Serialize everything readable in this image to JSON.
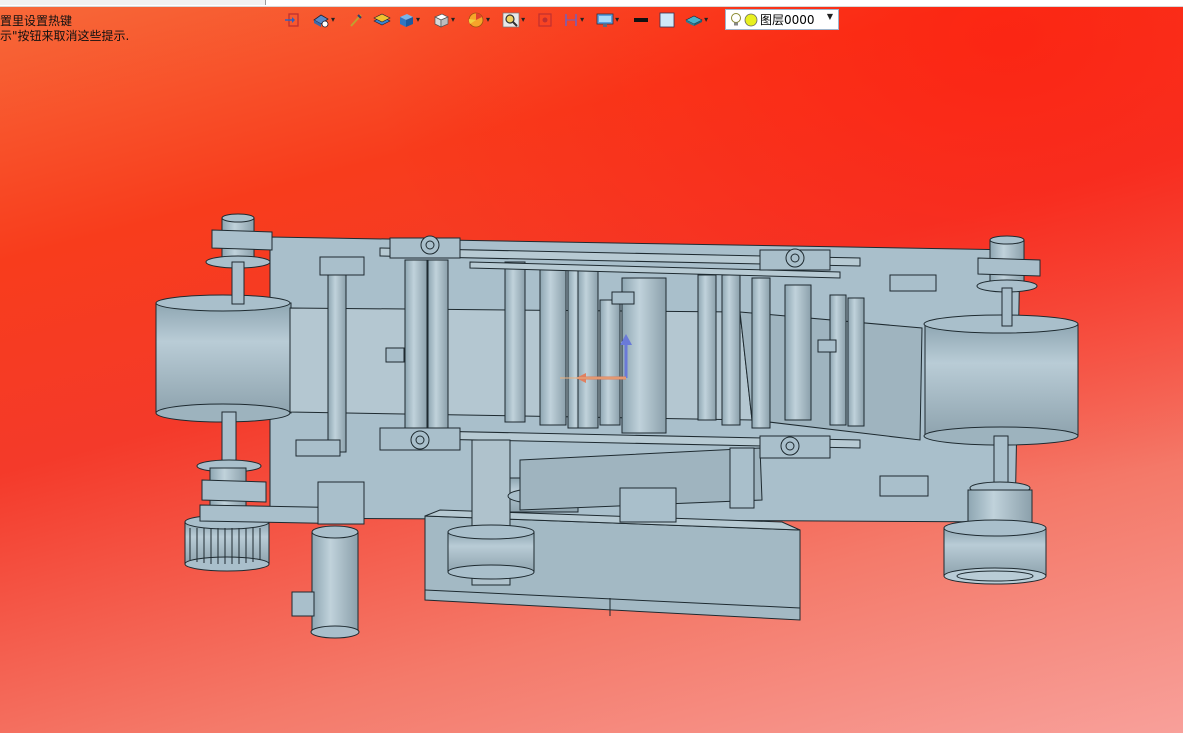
{
  "hints": {
    "line1": "置里设置热键",
    "line2": "示\"按钮来取消这些提示."
  },
  "toolbar": {
    "items": [
      {
        "name": "exit-sketch-icon"
      },
      {
        "name": "view-orientation-icon"
      },
      {
        "name": "line-style-icon"
      },
      {
        "name": "layers-icon"
      },
      {
        "name": "render-style-icon"
      },
      {
        "name": "standard-views-icon"
      },
      {
        "name": "color-wheel-icon"
      },
      {
        "name": "zoom-icon"
      },
      {
        "name": "fit-view-icon"
      },
      {
        "name": "section-view-icon"
      },
      {
        "name": "display-settings-icon"
      },
      {
        "name": "line-color-icon"
      },
      {
        "name": "fill-color-icon"
      },
      {
        "name": "material-icon"
      }
    ]
  },
  "layer": {
    "value": "图层0000"
  },
  "colors": {
    "part": "#a9bfcb",
    "edge": "#1e2a30",
    "background_top": "#f83c1c",
    "background_bottom": "#f8a09a"
  }
}
